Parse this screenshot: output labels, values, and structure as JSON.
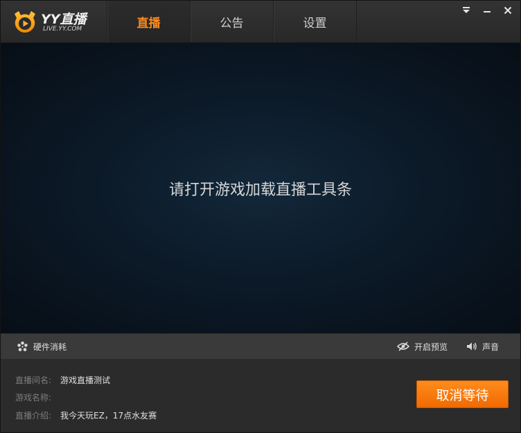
{
  "app": {
    "logo_title": "YY直播",
    "logo_sub": "LIVE.YY.COM",
    "accent_color": "#ff8a1c"
  },
  "tabs": [
    {
      "label": "直播",
      "active": true
    },
    {
      "label": "公告",
      "active": false
    },
    {
      "label": "设置",
      "active": false
    }
  ],
  "window_controls": {
    "menu_icon": "dropdown-menu-icon",
    "minimize_icon": "minimize-icon",
    "close_icon": "close-icon"
  },
  "video": {
    "message": "请打开游戏加载直播工具条"
  },
  "toolbar": {
    "hardware": {
      "label": "硬件消耗",
      "icon": "hardware-icon"
    },
    "preview": {
      "label": "开启预览",
      "icon": "eye-hidden-icon"
    },
    "sound": {
      "label": "声音",
      "icon": "speaker-icon"
    }
  },
  "info": {
    "room_name": {
      "label": "直播间名:",
      "value": "游戏直播测试"
    },
    "game_name": {
      "label": "游戏名称:",
      "value": ""
    },
    "intro": {
      "label": "直播介绍:",
      "value": "我今天玩EZ，17点水友赛"
    }
  },
  "actions": {
    "cancel_label": "取消等待"
  }
}
